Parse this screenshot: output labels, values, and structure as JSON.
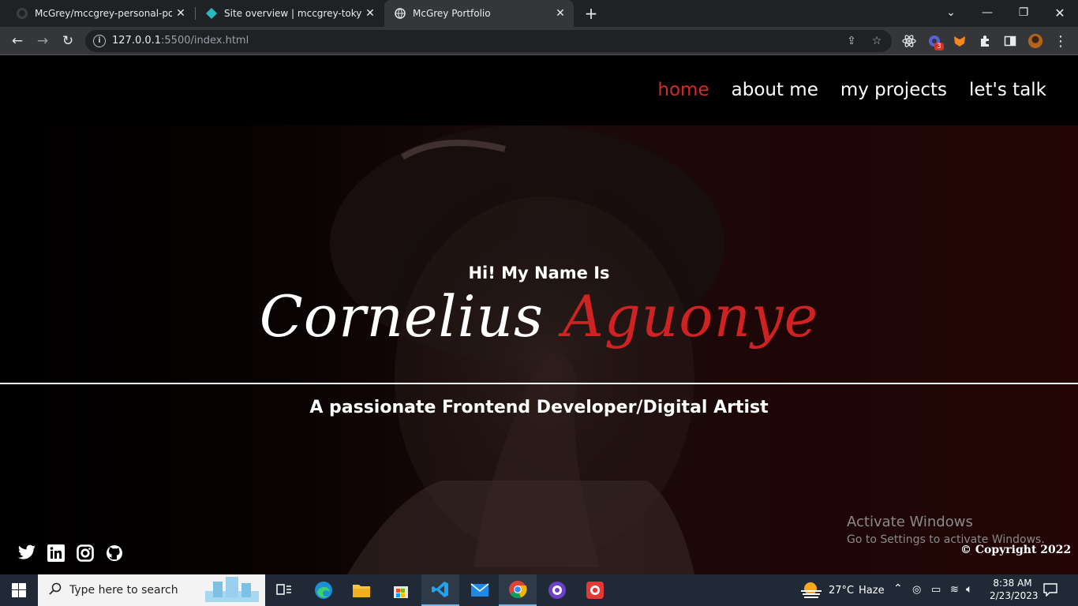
{
  "browser": {
    "tabs": [
      {
        "title": "McGrey/mccgrey-personal-portf",
        "close": "✕"
      },
      {
        "title": "Site overview | mccgrey-tokyo",
        "close": "✕"
      },
      {
        "title": "McGrey Portfolio",
        "close": "✕"
      }
    ],
    "new_tab": "+",
    "url_host": "127.0.0.1",
    "url_rest": ":5500/index.html",
    "extension_badge": "3"
  },
  "page": {
    "nav": [
      "home",
      "about me",
      "my projects",
      "let's talk"
    ],
    "greeting": "Hi! My Name Is",
    "first_name": "Cornelius",
    "last_name": "Aguonye",
    "tagline": "A passionate Frontend Developer/Digital Artist",
    "copyright": "© Copyright 2022",
    "socials": [
      "twitter-icon",
      "linkedin-icon",
      "instagram-icon",
      "github-icon"
    ],
    "accent_color": "#d42a2a"
  },
  "watermark": {
    "line1": "Activate Windows",
    "line2": "Go to Settings to activate Windows."
  },
  "taskbar": {
    "search_placeholder": "Type here to search",
    "weather_temp": "27°C",
    "weather_text": "Haze",
    "time": "8:38 AM",
    "date": "2/23/2023"
  }
}
